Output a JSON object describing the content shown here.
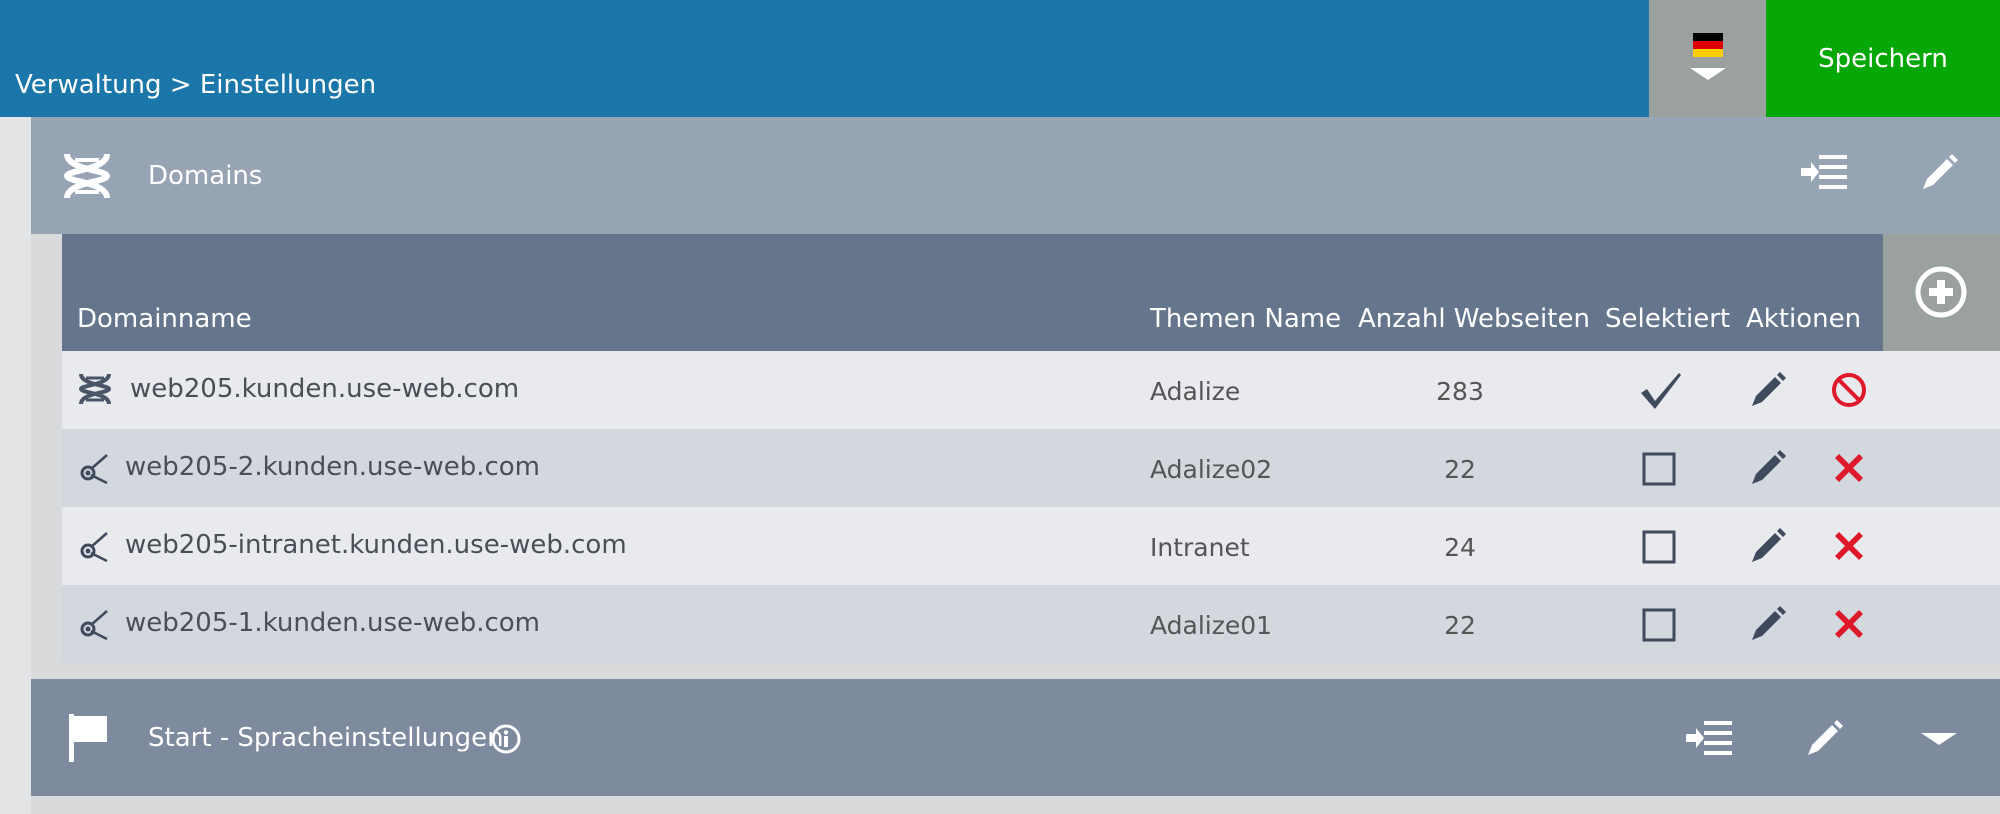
{
  "header": {
    "breadcrumb": "Verwaltung > Einstellungen",
    "save_label": "Speichern",
    "language": "de"
  },
  "domains_panel": {
    "title": "Domains"
  },
  "table": {
    "columns": [
      "Domainname",
      "Themen Name",
      "Anzahl Webseiten",
      "Selektiert",
      "Aktionen"
    ],
    "rows": [
      {
        "domain": "web205.kunden.use-web.com",
        "theme": "Adalize",
        "count": "283",
        "selected": true
      },
      {
        "domain": "web205-2.kunden.use-web.com",
        "theme": "Adalize02",
        "count": "22",
        "selected": false
      },
      {
        "domain": "web205-intranet.kunden.use-web.com",
        "theme": "Intranet",
        "count": "24",
        "selected": false
      },
      {
        "domain": "web205-1.kunden.use-web.com",
        "theme": "Adalize01",
        "count": "22",
        "selected": false
      }
    ]
  },
  "start_panel": {
    "title": "Start - Spracheinstellungen"
  },
  "colors": {
    "topbar": "#1b76aa",
    "save": "#05a806",
    "delete": "#e0192a"
  }
}
